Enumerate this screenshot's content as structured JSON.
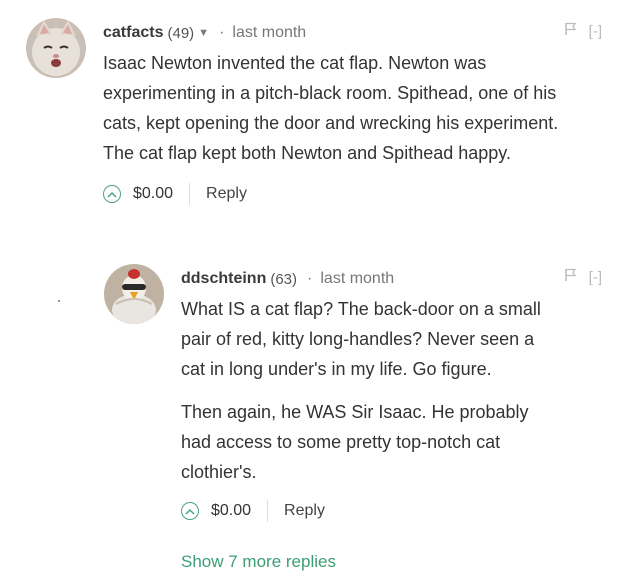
{
  "comments": [
    {
      "author": "catfacts",
      "reputation": "(49)",
      "separator": "·",
      "time": "last month",
      "collapse": "[-]",
      "paragraphs": [
        "Isaac Newton invented the cat flap. Newton was experimenting in a pitch-black room. Spithead, one of his cats, kept opening the door and wrecking his experiment. The cat flap kept both Newton and Spithead happy."
      ],
      "amount": "$0.00",
      "reply": "Reply"
    },
    {
      "author": "ddschteinn",
      "reputation": "(63)",
      "separator": "·",
      "time": "last month",
      "collapse": "[-]",
      "paragraphs": [
        "What IS a cat flap? The back-door on a small pair of red, kitty long-handles? Never seen a cat in long under's in my life. Go figure.",
        "Then again, he WAS Sir Isaac. He probably had access to some pretty top-notch cat clothier's."
      ],
      "amount": "$0.00",
      "reply": "Reply"
    }
  ],
  "show_more": "Show 7 more replies",
  "colors": {
    "accent": "#3d9d77",
    "text": "#333333",
    "muted": "#777777"
  },
  "icons": [
    "cat-avatar",
    "costume-avatar",
    "dropdown-caret-icon",
    "flag-icon",
    "upvote-icon"
  ]
}
